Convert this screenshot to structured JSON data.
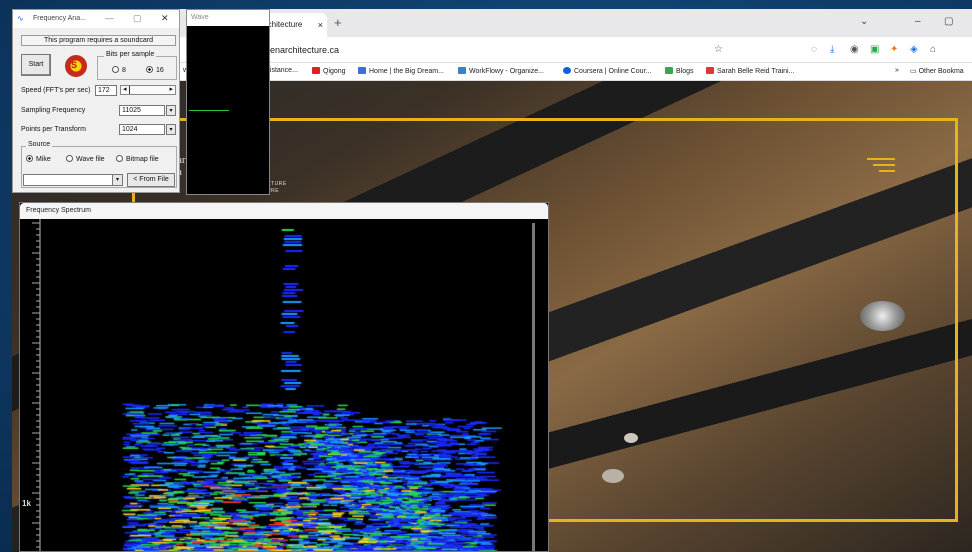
{
  "browser": {
    "active_tab_label": "rchitecture",
    "tab_close": "×",
    "new_tab": "+",
    "window_controls": [
      "⌄",
      "–",
      "▢"
    ],
    "url": "enarchitecture.ca",
    "toolbar_icons": [
      "star-icon",
      "pocket-icon",
      "download-icon",
      "account-icon",
      "extension-icon",
      "extension-icon",
      "extension-icon",
      "extension-icon"
    ],
    "bookmarks": [
      {
        "label": "w",
        "color": "#777777"
      },
      {
        "label": "distance...",
        "color": "#777777"
      },
      {
        "label": "Qigong",
        "color": "#e02020"
      },
      {
        "label": "Home | the Big Dream...",
        "color": "#3a6fd8"
      },
      {
        "label": "WorkFlowy - Organize...",
        "color": "#3a7fd0"
      },
      {
        "label": "Coursera | Online Cour...",
        "color": "#0f5fd8"
      },
      {
        "label": "Blogs",
        "color": "#3aa84a"
      },
      {
        "label": "Sarah Belle Reid Traini...",
        "color": "#d83a3a"
      }
    ],
    "overflow_chevron": "»",
    "other_bookmarks": "Other Bookma"
  },
  "website": {
    "brand_line1": "ar",
    "brand_line2": "a",
    "brand_sub1": "CTURE",
    "brand_sub2": "URE",
    "accent": "#e8b21a"
  },
  "analyzer": {
    "title": "Frequency Ana...",
    "controls": [
      "—",
      "▢",
      "✕"
    ],
    "message": "This program requires a soundcard",
    "start_label": "Start",
    "logo_letter": "S",
    "bits_legend": "Bits per sample",
    "bits_options": [
      "8",
      "16"
    ],
    "bits_selected": "16",
    "speed_label": "Speed (FFT's per sec)",
    "speed_value": "172",
    "sampling_label": "Sampling Frequency",
    "sampling_value": "11025",
    "points_label": "Points per Transform",
    "points_value": "1024",
    "source_legend": "Source",
    "source_options": [
      "Mike",
      "Wave file",
      "Bitmap file"
    ],
    "source_selected": "Mike",
    "from_file_label": "< From File"
  },
  "wave_window": {
    "title": "Wave"
  },
  "spectrum_window": {
    "title": "Frequency Spectrum",
    "axis_label": "1k"
  }
}
